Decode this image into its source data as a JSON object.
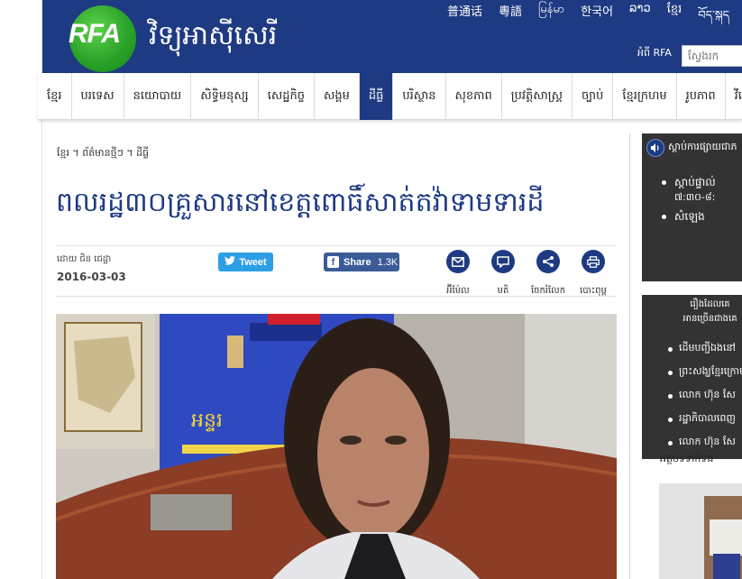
{
  "header": {
    "logo_text": "RFA",
    "site_name": "វិទ្យុអាស៊ីសេរី",
    "languages": [
      "普通话",
      "粵語",
      "မြန်မာ",
      "한국어",
      "ລາວ",
      "ខ្មែរ",
      "བོད་སྐད"
    ],
    "about_link": "អំពី RFA",
    "search_placeholder": "ស្វែងរក"
  },
  "nav": {
    "items": [
      {
        "label": "ខ្មែរ",
        "active": false
      },
      {
        "label": "បរទេស",
        "active": false
      },
      {
        "label": "នយោបាយ",
        "active": false
      },
      {
        "label": "សិទ្ធិមនុស្ស",
        "active": false
      },
      {
        "label": "សេដ្ឋកិច្ច",
        "active": false
      },
      {
        "label": "សង្គម",
        "active": false
      },
      {
        "label": "ដីធ្លី",
        "active": true
      },
      {
        "label": "បរិស្ថាន",
        "active": false
      },
      {
        "label": "សុខភាព",
        "active": false
      },
      {
        "label": "ប្រវត្តិសាស្ត្រ",
        "active": false
      },
      {
        "label": "ច្បាប់",
        "active": false
      },
      {
        "label": "ខ្មែរក្រហម",
        "active": false
      },
      {
        "label": "រូបភាព",
        "active": false
      },
      {
        "label": "វីដេអូ",
        "active": false
      }
    ]
  },
  "article": {
    "breadcrumb": "ខ្មែរ ។ ព័ត៌មានថ្មីៗ ។ ដីធ្លី",
    "headline": "ពលរដ្ឋ៣០គ្រួសារនៅខេត្តពោធិ៍សាត់តវ៉ាទាមទារដី",
    "byline": "ដោយ ជិន ជេដ្ឋា",
    "date": "2016-03-03",
    "tweet_label": "Tweet",
    "share_label": "Share",
    "share_count": "1.3K",
    "tools": [
      "អ៊ីម៉ែល",
      "មតិ",
      "ចែករំលែក",
      "បោះពុម្ព"
    ]
  },
  "sidebar": {
    "listen_title": "ស្ដាប់ការផ្សាយជាភ",
    "listen_items": [
      {
        "label": "ស្ដាប់ផ្ទាល់",
        "sub": "៧:៣០-៨:"
      },
      {
        "label": "សំឡេង",
        "sub": ""
      }
    ],
    "popular_title_1": "រឿងដែលគេ",
    "popular_title_2": "អានច្រើនជាងគេ",
    "popular_items": [
      "ដើមបញ្ជីឯងនៅ",
      "ព្រះសង្ឃខ្មែរក្រោម",
      "លោក ហ៊ុន សែ",
      "រដ្ឋាភិបាលពេញ",
      "លោក ហ៊ុន សែ"
    ],
    "more_label": "អត្ថបទទាក់ទង"
  },
  "colors": {
    "brand_blue": "#1e3a82",
    "sidebar_dark": "#333333",
    "tweet_blue": "#2d9fe6",
    "facebook_blue": "#3b5b98"
  }
}
